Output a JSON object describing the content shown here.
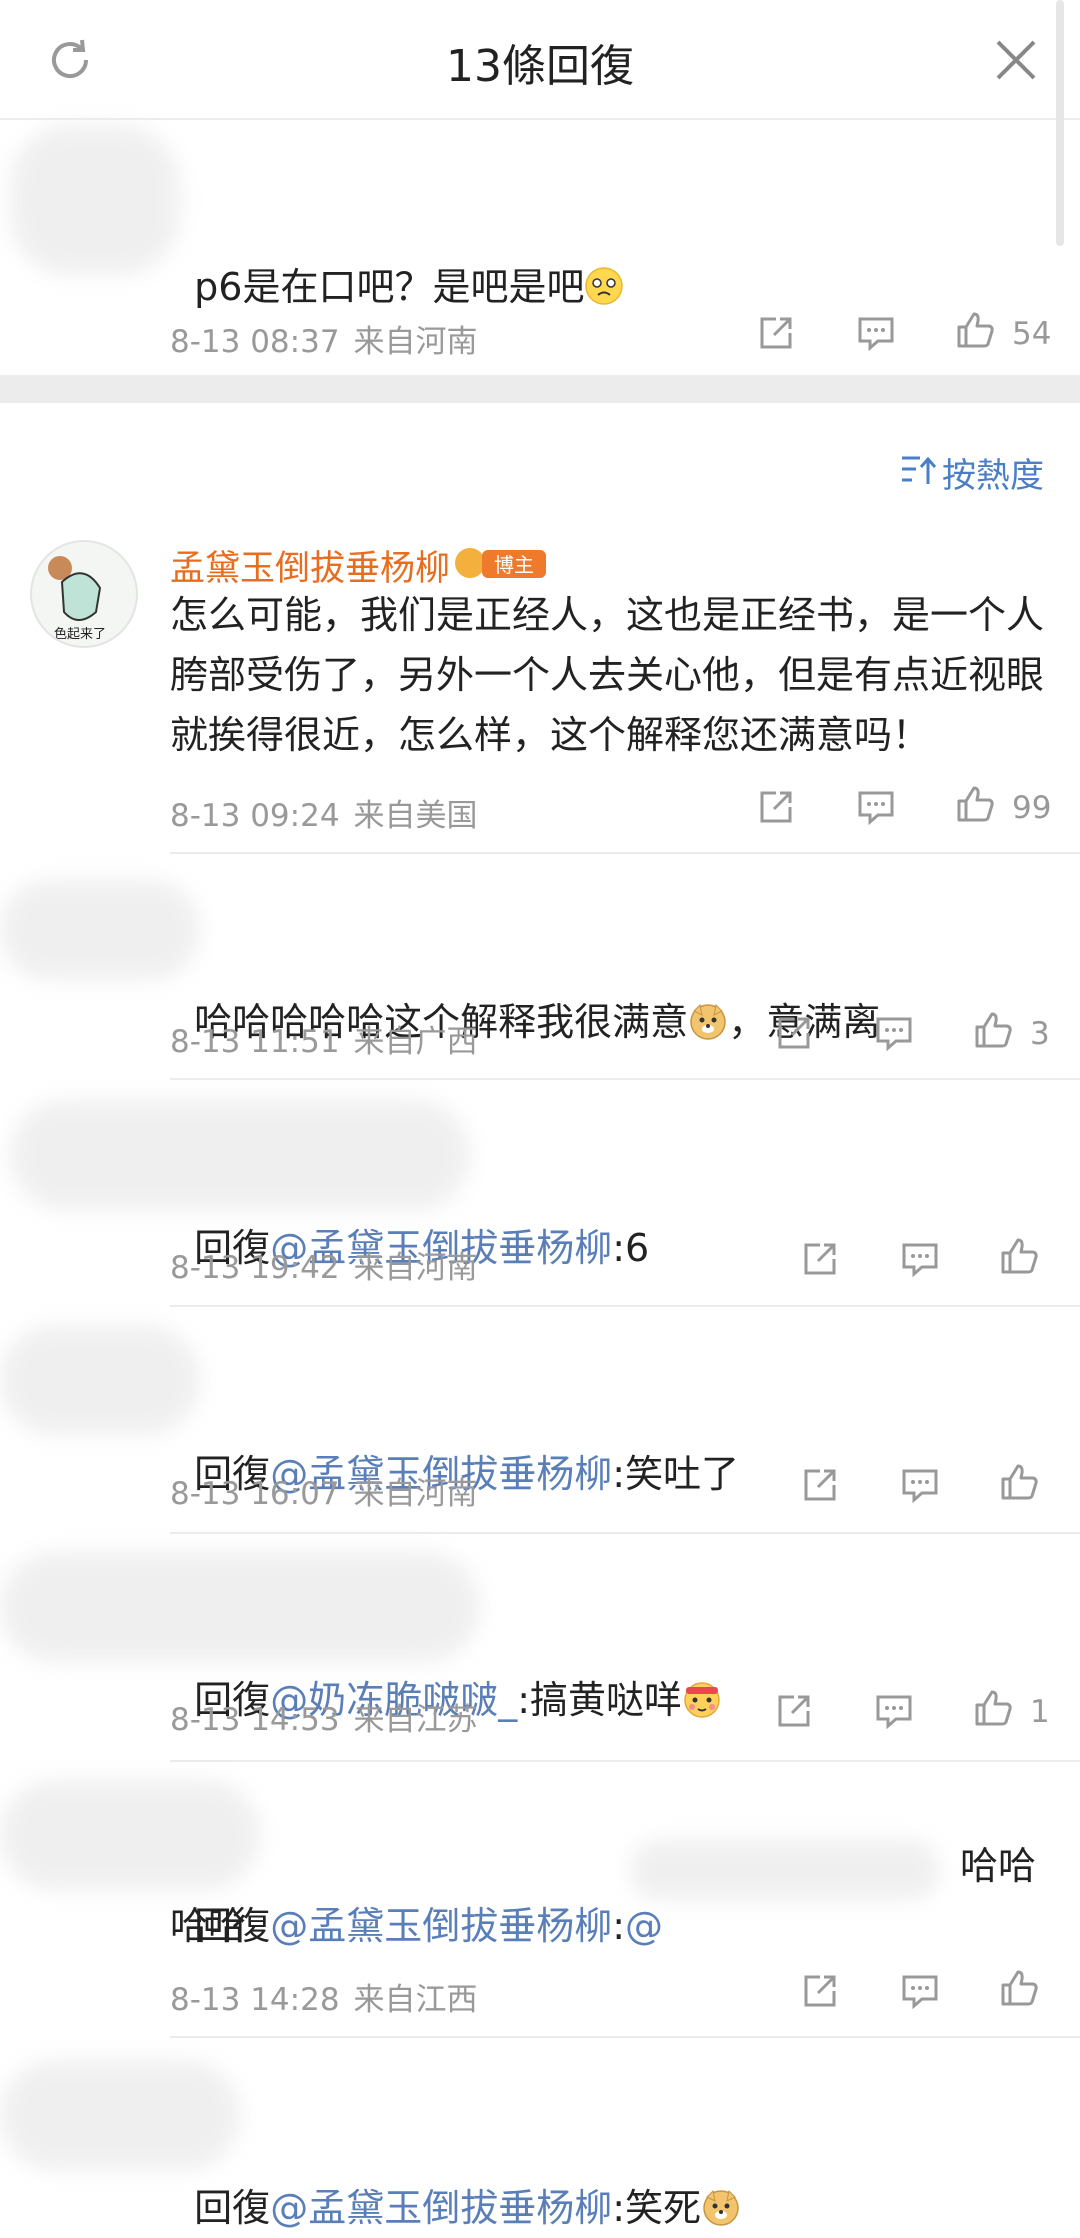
{
  "header": {
    "title": "13條回復"
  },
  "top_comment": {
    "text": "p6是在口吧？是吧是吧",
    "date": "8-13 08:37",
    "location": "来自河南",
    "likes": "54"
  },
  "sort": {
    "label": "按熱度"
  },
  "main_comment": {
    "username": "孟黛玉倒拔垂杨柳",
    "badge": "博主",
    "avatar_text": "色起来了",
    "text": "怎么可能，我们是正经人，这也是正经书，是一个人胯部受伤了，另外一个人去关心他，但是有点近视眼就挨得很近，怎么样，这个解释您还满意吗！",
    "date": "8-13 09:24",
    "location": "来自美国",
    "likes": "99"
  },
  "replies": [
    {
      "prefix": "",
      "mention": "",
      "text": "哈哈哈哈哈这个解释我很满意",
      "suffix": "，意满离",
      "date": "8-13 11:51",
      "location": "来自广西",
      "likes": "3"
    },
    {
      "prefix": "回復",
      "mention": "@孟黛玉倒拔垂杨柳",
      "text": ":6",
      "date": "8-13 19:42",
      "location": "来自河南",
      "likes": ""
    },
    {
      "prefix": "回復",
      "mention": "@孟黛玉倒拔垂杨柳",
      "text": ":笑吐了",
      "date": "8-13 16:07",
      "location": "来自河南",
      "likes": ""
    },
    {
      "prefix": "回復",
      "mention": "@奶冻脆啵啵_",
      "text": ":搞黄哒咩",
      "date": "8-13 14:53",
      "location": "来自江苏",
      "likes": "1"
    },
    {
      "prefix": "回復",
      "mention": "@孟黛玉倒拔垂杨柳",
      "text": ":",
      "mention2": "@",
      "tail": "哈哈",
      "tail2": "哈哈",
      "date": "8-13 14:28",
      "location": "来自江西",
      "likes": ""
    },
    {
      "prefix": "回復",
      "mention": "@孟黛玉倒拔垂杨柳",
      "text": ":笑死"
    }
  ]
}
